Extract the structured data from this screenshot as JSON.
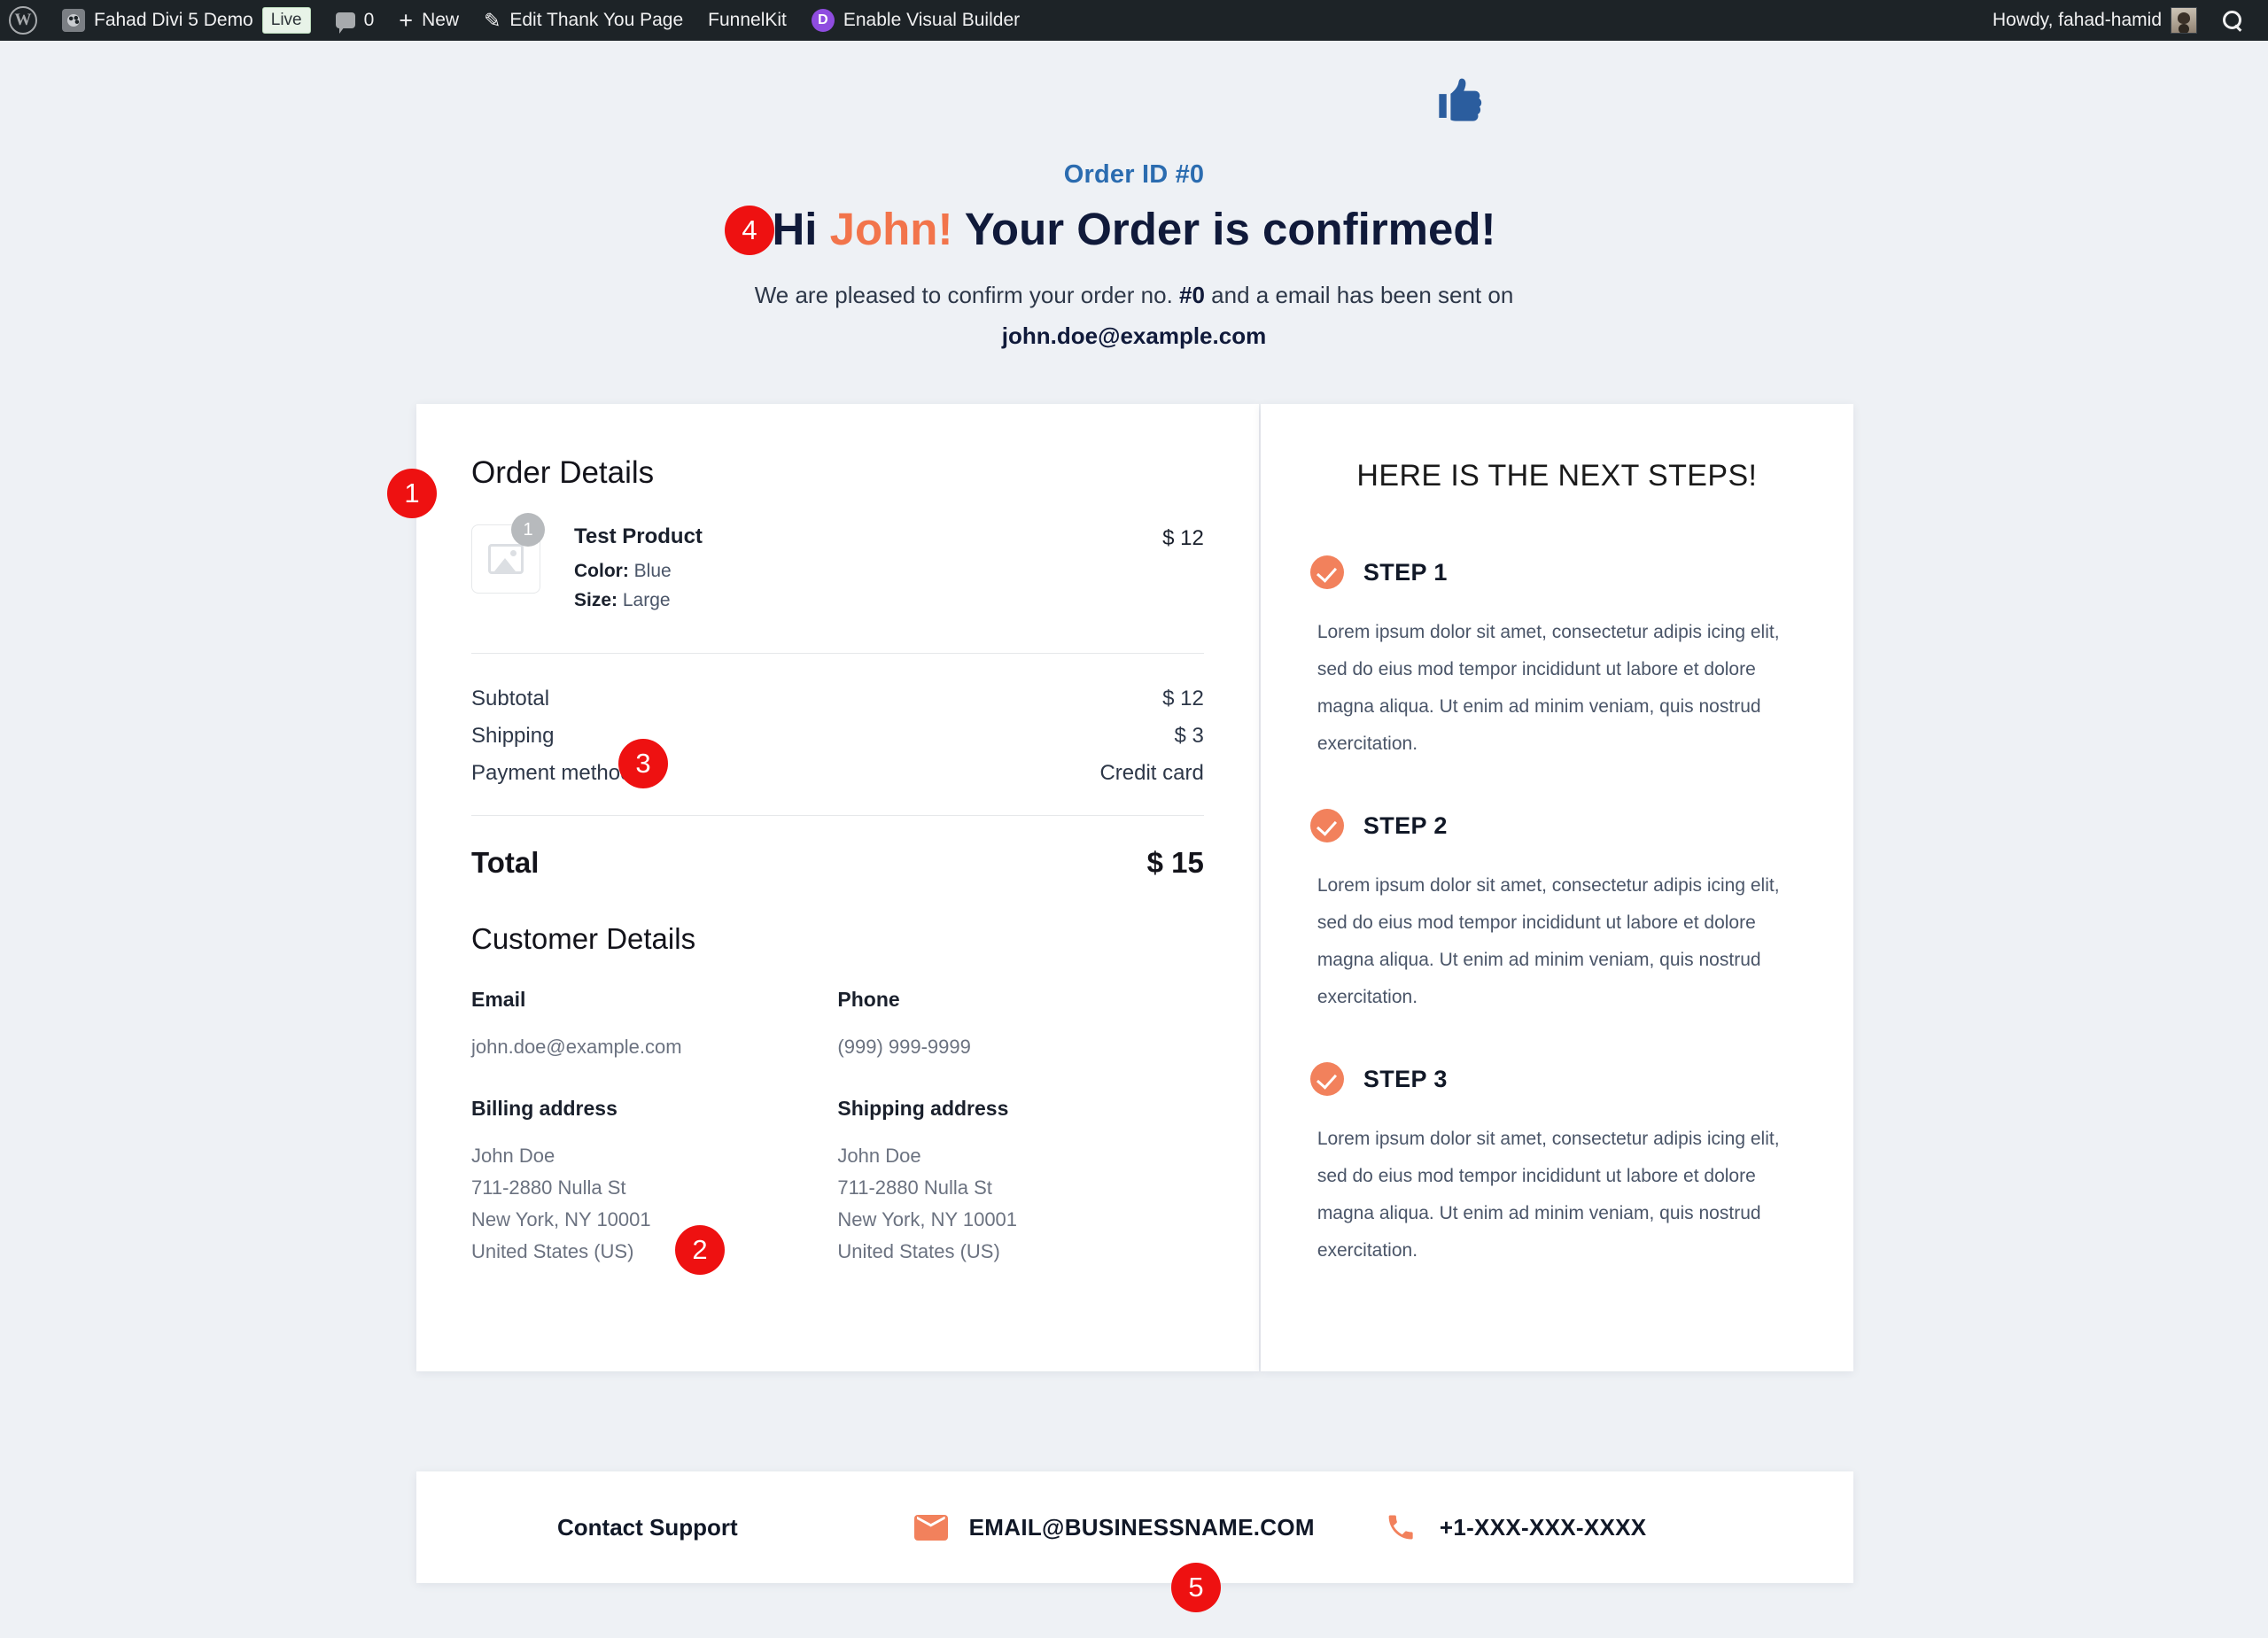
{
  "adminbar": {
    "wp_logo": "wordpress-logo",
    "site_name": "Fahad Divi 5 Demo",
    "live_badge": "Live",
    "comment_count": "0",
    "new_label": "New",
    "edit_label": "Edit Thank You Page",
    "funnelkit_label": "FunnelKit",
    "divi_badge": "D",
    "visual_builder_label": "Enable Visual Builder",
    "howdy": "Howdy, fahad-hamid",
    "search_icon": "search-icon",
    "avatar": "user-avatar"
  },
  "hero": {
    "thumb_icon": "thumbs-up-icon",
    "order_id": "Order ID #0",
    "greeting_prefix": "Hi ",
    "customer_name": "John!",
    "greeting_suffix": " Your Order is confirmed!",
    "subline_part1": "We are pleased to confirm your order no. ",
    "subline_order_no": "#0",
    "subline_part2": " and a email has been sent on",
    "email": "john.doe@example.com"
  },
  "order_details": {
    "title": "Order Details",
    "items": [
      {
        "thumb_icon": "image-placeholder-icon",
        "qty": "1",
        "name": "Test Product",
        "attr1_label": "Color:",
        "attr1_value": "Blue",
        "attr2_label": "Size:",
        "attr2_value": "Large",
        "price": "$ 12"
      }
    ],
    "totals": [
      {
        "label": "Subtotal",
        "value": "$ 12"
      },
      {
        "label": "Shipping",
        "value": "$ 3"
      },
      {
        "label": "Payment method",
        "value": "Credit card"
      }
    ],
    "total_label": "Total",
    "total_value": "$ 15"
  },
  "customer_details": {
    "title": "Customer Details",
    "email_label": "Email",
    "email_value": "john.doe@example.com",
    "phone_label": "Phone",
    "phone_value": "(999) 999-9999",
    "billing_label": "Billing address",
    "billing_value": "John Doe\n711-2880 Nulla St\nNew York, NY 10001\nUnited States (US)",
    "shipping_label": "Shipping address",
    "shipping_value": "John Doe\n711-2880 Nulla St\nNew York, NY 10001\nUnited States (US)"
  },
  "next_steps": {
    "title": "HERE IS THE NEXT STEPS!",
    "steps": [
      {
        "icon": "check-circle-icon",
        "label": "STEP 1",
        "body": "Lorem ipsum dolor sit amet, consectetur adipis icing elit, sed do eius mod tempor incididunt ut labore et dolore magna aliqua. Ut enim ad minim veniam, quis nostrud exercitation."
      },
      {
        "icon": "check-circle-icon",
        "label": "STEP 2",
        "body": "Lorem ipsum dolor sit amet, consectetur adipis icing elit, sed do eius mod tempor incididunt ut labore et dolore magna aliqua. Ut enim ad minim veniam, quis nostrud exercitation."
      },
      {
        "icon": "check-circle-icon",
        "label": "STEP 3",
        "body": "Lorem ipsum dolor sit amet, consectetur adipis icing elit, sed do eius mod tempor incididunt ut labore et dolore magna aliqua. Ut enim ad minim veniam, quis nostrud exercitation."
      }
    ]
  },
  "footer": {
    "support_label": "Contact Support",
    "email_icon": "envelope-icon",
    "email": "EMAIL@BUSINESSNAME.COM",
    "phone_icon": "phone-icon",
    "phone": "+1-XXX-XXX-XXXX"
  },
  "annotations": [
    {
      "id": "1",
      "target": "order-details-section"
    },
    {
      "id": "2",
      "target": "billing-address"
    },
    {
      "id": "3",
      "target": "payment-method-row"
    },
    {
      "id": "4",
      "target": "confirmation-headline"
    },
    {
      "id": "5",
      "target": "footer-contact-email"
    }
  ],
  "colors": {
    "page_bg": "#eef1f5",
    "admin_bar": "#1d2327",
    "accent_blue": "#2b6cb0",
    "accent_orange": "#f2815c",
    "headline_navy": "#101a3a",
    "marker_red": "#ee1111"
  }
}
